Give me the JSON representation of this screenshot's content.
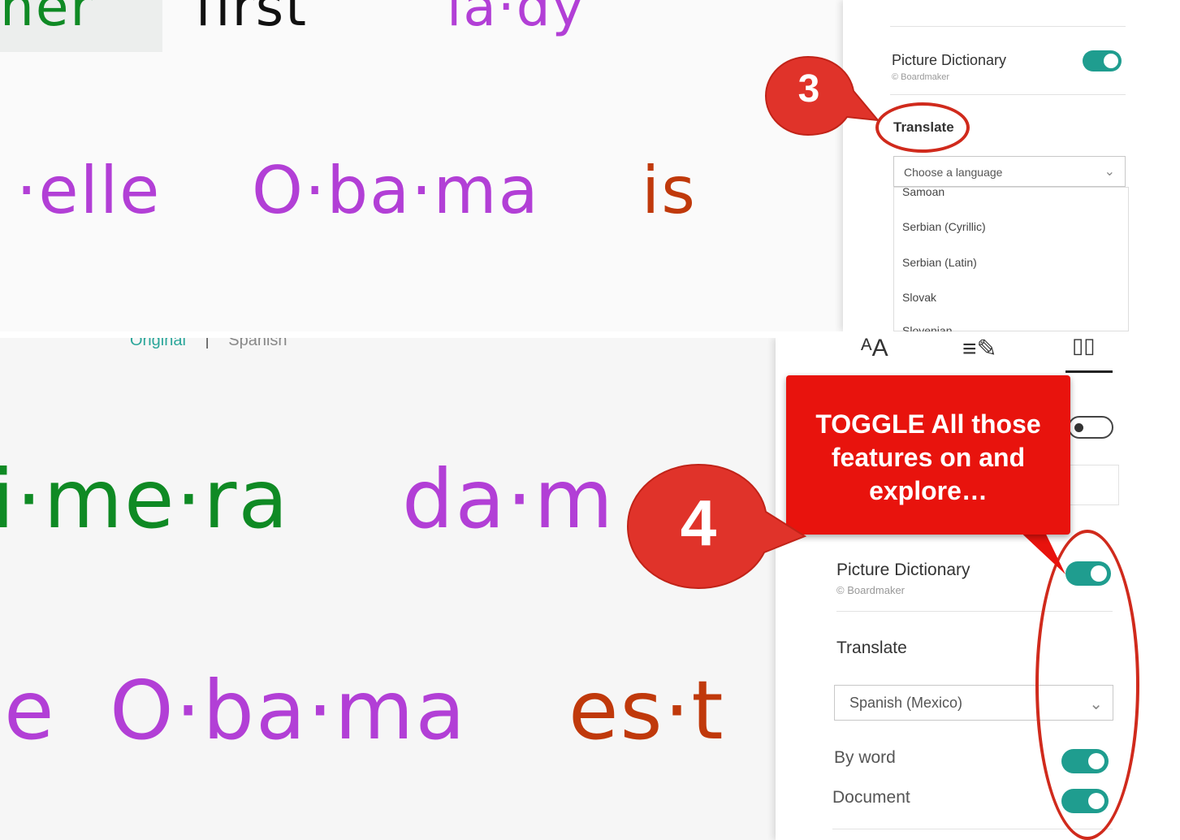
{
  "top_panel": {
    "reading_line1": [
      "ner",
      "first",
      "la·dy"
    ],
    "reading_line2": [
      "·elle",
      "O·ba·ma",
      "is"
    ],
    "sidebar": {
      "picture_dictionary_label": "Picture Dictionary",
      "picture_dictionary_credit": "© Boardmaker",
      "picture_dictionary_on": true,
      "translate_label": "Translate",
      "language_placeholder": "Choose a language",
      "language_options": [
        "Samoan",
        "Serbian (Cyrillic)",
        "Serbian (Latin)",
        "Slovak",
        "Slovenian"
      ]
    },
    "callout_number": "3"
  },
  "bottom_panel": {
    "view_tabs": [
      "Original",
      "Spanish"
    ],
    "tab_separator": "|",
    "reading_line1": [
      "i·me·ra",
      "da·m"
    ],
    "reading_line2": [
      "e",
      "O·ba·ma",
      "es·t"
    ],
    "sidebar": {
      "toolbar_icons": [
        "text-size-icon",
        "grammar-options-icon",
        "reading-preferences-icon"
      ],
      "text_size_glyph": "ᴬA",
      "grammar_glyph": "≡✎",
      "reading_glyph": "▯▯",
      "picture_dictionary_label": "Picture Dictionary",
      "picture_dictionary_credit": "© Boardmaker",
      "picture_dictionary_on": true,
      "translate_label": "Translate",
      "language_selected": "Spanish (Mexico)",
      "by_word_label": "By word",
      "by_word_on": true,
      "document_label": "Document",
      "document_on": true
    },
    "callout_number": "4",
    "tip_text": "TOGGLE All those features on and explore…"
  },
  "colors": {
    "callout_red": "#e8130d",
    "toggle_teal": "#1f9d8f",
    "syllable_green": "#0f8a24",
    "syllable_purple": "#b23fd6",
    "syllable_red": "#c0390b"
  }
}
